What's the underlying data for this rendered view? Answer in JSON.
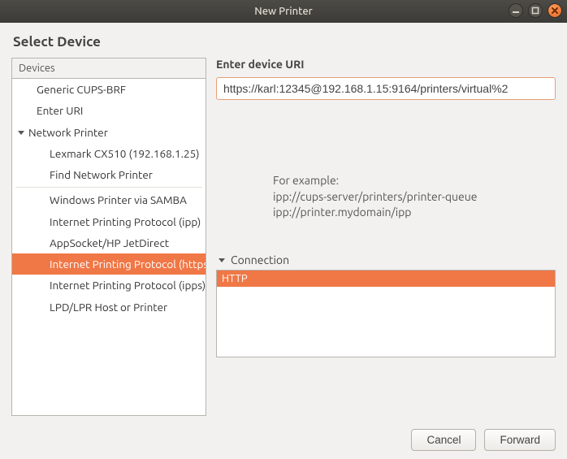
{
  "window": {
    "title": "New Printer"
  },
  "page": {
    "heading": "Select Device"
  },
  "devices": {
    "header": "Devices",
    "items": [
      {
        "label": "Generic CUPS-BRF",
        "level": 1,
        "selected": false,
        "type": "leaf"
      },
      {
        "label": "Enter URI",
        "level": 1,
        "selected": false,
        "type": "leaf"
      },
      {
        "label": "Network Printer",
        "level": 0,
        "selected": false,
        "type": "group",
        "expanded": true
      },
      {
        "label": "Lexmark CX510 (192.168.1.25)",
        "level": 2,
        "selected": false,
        "type": "leaf"
      },
      {
        "label": "Find Network Printer",
        "level": 2,
        "selected": false,
        "type": "leaf"
      },
      {
        "type": "divider"
      },
      {
        "label": "Windows Printer via SAMBA",
        "level": 2,
        "selected": false,
        "type": "leaf"
      },
      {
        "label": "Internet Printing Protocol (ipp)",
        "level": 2,
        "selected": false,
        "type": "leaf"
      },
      {
        "label": "AppSocket/HP JetDirect",
        "level": 2,
        "selected": false,
        "type": "leaf"
      },
      {
        "label": "Internet Printing Protocol (https)",
        "level": 2,
        "selected": true,
        "type": "leaf"
      },
      {
        "label": "Internet Printing Protocol (ipps)",
        "level": 2,
        "selected": false,
        "type": "leaf"
      },
      {
        "label": "LPD/LPR Host or Printer",
        "level": 2,
        "selected": false,
        "type": "leaf"
      }
    ]
  },
  "uri": {
    "label": "Enter device URI",
    "value": "https://karl:12345@192.168.1.15:9164/printers/virtual%2",
    "example_label": "For example:",
    "example1": "ipp://cups-server/printers/printer-queue",
    "example2": "ipp://printer.mydomain/ipp"
  },
  "connection": {
    "header": "Connection",
    "rows": [
      {
        "label": "HTTP",
        "selected": true
      }
    ]
  },
  "buttons": {
    "cancel": "Cancel",
    "forward": "Forward"
  }
}
